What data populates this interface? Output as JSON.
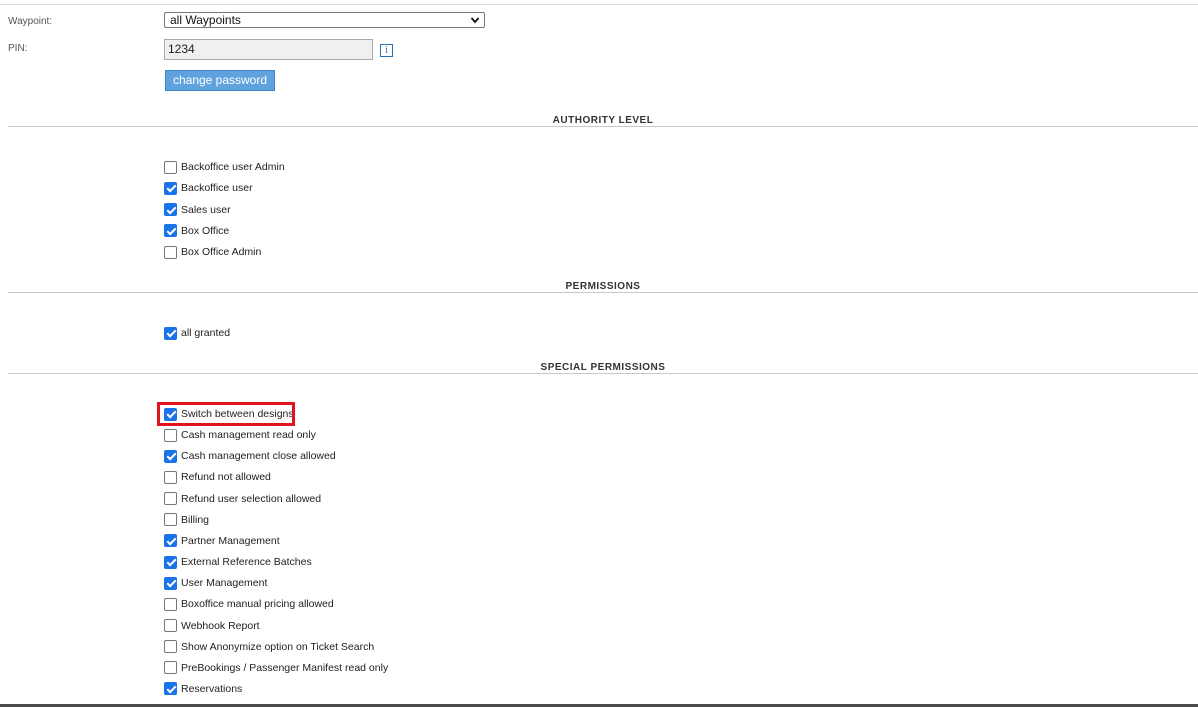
{
  "form": {
    "waypoint_label": "Waypoint:",
    "waypoint_value": "all Waypoints",
    "pin_label": "PIN:",
    "pin_value": "1234",
    "info_glyph": "i",
    "change_password_label": "change password"
  },
  "sections": {
    "authority_title": "AUTHORITY LEVEL",
    "permissions_title": "PERMISSIONS",
    "special_title": "SPECIAL PERMISSIONS"
  },
  "authority": [
    {
      "label": "Backoffice user Admin",
      "checked": false
    },
    {
      "label": "Backoffice user",
      "checked": true
    },
    {
      "label": "Sales user",
      "checked": true
    },
    {
      "label": "Box Office",
      "checked": true
    },
    {
      "label": "Box Office Admin",
      "checked": false
    }
  ],
  "permissions": [
    {
      "label": "all granted",
      "checked": true
    }
  ],
  "special": [
    {
      "label": "Switch between designs",
      "checked": true
    },
    {
      "label": "Cash management read only",
      "checked": false
    },
    {
      "label": "Cash management close allowed",
      "checked": true
    },
    {
      "label": "Refund not allowed",
      "checked": false
    },
    {
      "label": "Refund user selection allowed",
      "checked": false
    },
    {
      "label": "Billing",
      "checked": false
    },
    {
      "label": "Partner Management",
      "checked": true
    },
    {
      "label": "External Reference Batches",
      "checked": true
    },
    {
      "label": "User Management",
      "checked": true
    },
    {
      "label": "Boxoffice manual pricing allowed",
      "checked": false
    },
    {
      "label": "Webhook Report",
      "checked": false
    },
    {
      "label": "Show Anonymize option on Ticket Search",
      "checked": false
    },
    {
      "label": "PreBookings / Passenger Manifest read only",
      "checked": false
    },
    {
      "label": "Reservations",
      "checked": true
    }
  ],
  "colors": {
    "checkbox_checked": "#1a73e8",
    "button_bg": "#5fa2dd",
    "highlight": "#e0141e"
  }
}
